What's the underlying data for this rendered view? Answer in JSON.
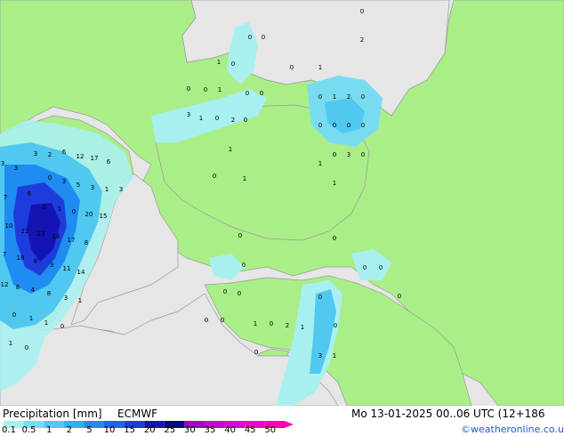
{
  "footer": {
    "title": "Precipitation [mm]",
    "model": "ECMWF",
    "datetime": "Mo 13-01-2025 00..06 UTC (12+186",
    "credit": "©weatheronline.co.uk"
  },
  "legend": {
    "ticks": [
      "0.1",
      "0.5",
      "1",
      "2",
      "5",
      "10",
      "15",
      "20",
      "25",
      "30",
      "35",
      "40",
      "45",
      "50"
    ],
    "colors": [
      "#a8f0f0",
      "#78dcf0",
      "#50c8f0",
      "#28b4ec",
      "#1e8cf0",
      "#1e64f0",
      "#1e3cdc",
      "#1414b4",
      "#0a0a80",
      "#a000c8",
      "#c800d2",
      "#dc00dc",
      "#f000c8",
      "#ff00b4"
    ]
  },
  "colors": {
    "land": "#aaee88",
    "sea": "#e6e6e6",
    "precip_light": "#a8f0f0",
    "precip_mid": "#50c8f0",
    "precip_heavy": "#1e3cdc",
    "precip_max": "#1414b4"
  },
  "map_labels": {
    "values": [
      "0",
      "2",
      "0",
      "0",
      "0",
      "1",
      "0",
      "1",
      "0",
      "0",
      "1",
      "0",
      "0",
      "0",
      "1",
      "2",
      "0",
      "1",
      "0",
      "2",
      "0",
      "3",
      "0",
      "0",
      "0",
      "0",
      "0",
      "3",
      "0",
      "1",
      "1",
      "0",
      "1",
      "1",
      "3",
      "3",
      "3",
      "2",
      "6",
      "12",
      "17",
      "6",
      "0",
      "3",
      "5",
      "3",
      "1",
      "3",
      "7",
      "6",
      "0",
      "1",
      "0",
      "20",
      "15",
      "10",
      "22",
      "13",
      "16",
      "17",
      "8",
      "7",
      "18",
      "6",
      "3",
      "11",
      "14",
      "12",
      "8",
      "4",
      "8",
      "3",
      "1",
      "0",
      "1",
      "1",
      "0",
      "1",
      "0",
      "0",
      "0",
      "0",
      "0",
      "0",
      "0",
      "0",
      "0",
      "0",
      "0",
      "1",
      "0",
      "2",
      "1",
      "0",
      "0",
      "0",
      "3",
      "1"
    ]
  }
}
